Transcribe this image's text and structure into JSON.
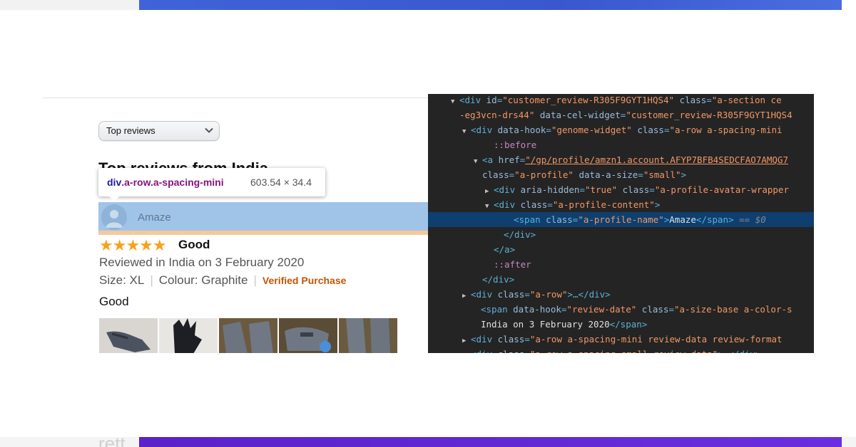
{
  "sort": {
    "selected": "Top reviews"
  },
  "heading": "Top reviews from India",
  "tooltip": {
    "tag": "div",
    "classes": ".a-row.a-spacing-mini",
    "dimensions": "603.54 × 34.4"
  },
  "review": {
    "profile_name": "Amaze",
    "rating_stars": "★★★★★",
    "title": "Good",
    "date": "Reviewed in India on 3 February 2020",
    "size": "Size: XL",
    "colour": "Colour: Graphite",
    "verified": "Verified Purchase",
    "body": "Good"
  },
  "footer_fragment": "rett",
  "devtools": {
    "lines": [
      {
        "tri": "▼",
        "parts": [
          [
            "t",
            "<div "
          ],
          [
            "a",
            "id"
          ],
          [
            "t",
            "="
          ],
          [
            "v",
            "\"customer_review-R305F9GYT1HQS4\""
          ],
          [
            "t",
            " "
          ],
          [
            "a",
            "class"
          ],
          [
            "t",
            "="
          ],
          [
            "v",
            "\"a-section ce"
          ]
        ]
      },
      {
        "tri": "",
        "parts": [
          [
            "v",
            "-eg3vcn-drs44\""
          ],
          [
            "t",
            " "
          ],
          [
            "a",
            "data-cel-widget"
          ],
          [
            "t",
            "="
          ],
          [
            "v",
            "\"customer_review-R305F9GYT1HQS4"
          ]
        ]
      },
      {
        "tri": "▼",
        "parts": [
          [
            "t",
            "<div "
          ],
          [
            "a",
            "data-hook"
          ],
          [
            "t",
            "="
          ],
          [
            "v",
            "\"genome-widget\""
          ],
          [
            "t",
            " "
          ],
          [
            "a",
            "class"
          ],
          [
            "t",
            "="
          ],
          [
            "v",
            "\"a-row a-spacing-mini"
          ]
        ]
      },
      {
        "tri": "",
        "parts": [
          [
            "p",
            "::before"
          ]
        ]
      },
      {
        "tri": "▼",
        "parts": [
          [
            "t",
            "<a "
          ],
          [
            "a",
            "href"
          ],
          [
            "t",
            "="
          ],
          [
            "lnk",
            "\"/gp/profile/amzn1.account.AFYP7BFB4SEDCFAO7AMQG7"
          ]
        ]
      },
      {
        "tri": "",
        "parts": [
          [
            "a",
            "class"
          ],
          [
            "t",
            "="
          ],
          [
            "v",
            "\"a-profile\""
          ],
          [
            "t",
            " "
          ],
          [
            "a",
            "data-a-size"
          ],
          [
            "t",
            "="
          ],
          [
            "v",
            "\"small\""
          ],
          [
            "t",
            ">"
          ]
        ]
      },
      {
        "tri": "▶",
        "parts": [
          [
            "t",
            "<div "
          ],
          [
            "a",
            "aria-hidden"
          ],
          [
            "t",
            "="
          ],
          [
            "v",
            "\"true\""
          ],
          [
            "t",
            " "
          ],
          [
            "a",
            "class"
          ],
          [
            "t",
            "="
          ],
          [
            "v",
            "\"a-profile-avatar-wrapper"
          ]
        ]
      },
      {
        "tri": "▼",
        "parts": [
          [
            "t",
            "<div "
          ],
          [
            "a",
            "class"
          ],
          [
            "t",
            "="
          ],
          [
            "v",
            "\"a-profile-content\""
          ],
          [
            "t",
            ">"
          ]
        ]
      },
      {
        "tri": "",
        "parts": [
          [
            "t",
            "<span "
          ],
          [
            "a",
            "class"
          ],
          [
            "t",
            "="
          ],
          [
            "v",
            "\"a-profile-name\""
          ],
          [
            "t",
            ">"
          ],
          [
            "txt",
            "Amaze"
          ],
          [
            "t",
            "</span>"
          ],
          [
            "cmt",
            " == $0"
          ]
        ]
      },
      {
        "tri": "",
        "parts": [
          [
            "t",
            "</div>"
          ]
        ]
      },
      {
        "tri": "",
        "parts": [
          [
            "t",
            "</a>"
          ]
        ]
      },
      {
        "tri": "",
        "parts": [
          [
            "p",
            "::after"
          ]
        ]
      },
      {
        "tri": "",
        "parts": [
          [
            "t",
            "</div>"
          ]
        ]
      },
      {
        "tri": "▶",
        "parts": [
          [
            "t",
            "<div "
          ],
          [
            "a",
            "class"
          ],
          [
            "t",
            "="
          ],
          [
            "v",
            "\"a-row\""
          ],
          [
            "t",
            ">…</div>"
          ]
        ]
      },
      {
        "tri": "",
        "parts": [
          [
            "t",
            "<span "
          ],
          [
            "a",
            "data-hook"
          ],
          [
            "t",
            "="
          ],
          [
            "v",
            "\"review-date\""
          ],
          [
            "t",
            " "
          ],
          [
            "a",
            "class"
          ],
          [
            "t",
            "="
          ],
          [
            "v",
            "\"a-size-base a-color-s"
          ]
        ]
      },
      {
        "tri": "",
        "parts": [
          [
            "txt",
            "India on 3 February 2020"
          ],
          [
            "t",
            "</span>"
          ]
        ]
      },
      {
        "tri": "▶",
        "parts": [
          [
            "t",
            "<div "
          ],
          [
            "a",
            "class"
          ],
          [
            "t",
            "="
          ],
          [
            "v",
            "\"a-row a-spacing-mini review-data review-format"
          ]
        ]
      },
      {
        "tri": "▶",
        "parts": [
          [
            "t",
            "<div "
          ],
          [
            "a",
            "class"
          ],
          [
            "t",
            "="
          ],
          [
            "v",
            "\"a-row a-spacing-small review-data\""
          ],
          [
            "t",
            ">…</div>"
          ]
        ]
      }
    ]
  }
}
